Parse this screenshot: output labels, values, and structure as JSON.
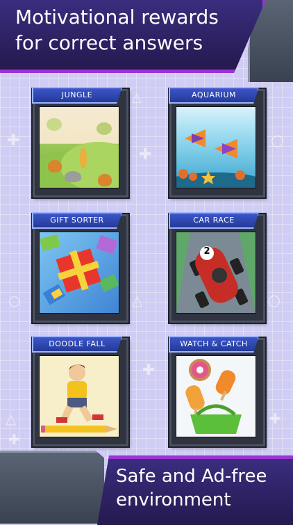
{
  "header": {
    "title_line1": "Motivational rewards",
    "title_line2": "for correct answers"
  },
  "footer": {
    "title_line1": "Safe and Ad-free",
    "title_line2": "environment"
  },
  "games": [
    {
      "label": "JUNGLE"
    },
    {
      "label": "AQUARIUM"
    },
    {
      "label": "GIFT SORTER"
    },
    {
      "label": "CAR RACE"
    },
    {
      "label": "DOODLE FALL"
    },
    {
      "label": "WATCH & CATCH"
    }
  ],
  "car_number": "2",
  "colors": {
    "banner_bg": "#2b1f63",
    "banner_border": "#9a34d6",
    "label_bg": "#2c47b8",
    "background": "#cfcdf3"
  }
}
